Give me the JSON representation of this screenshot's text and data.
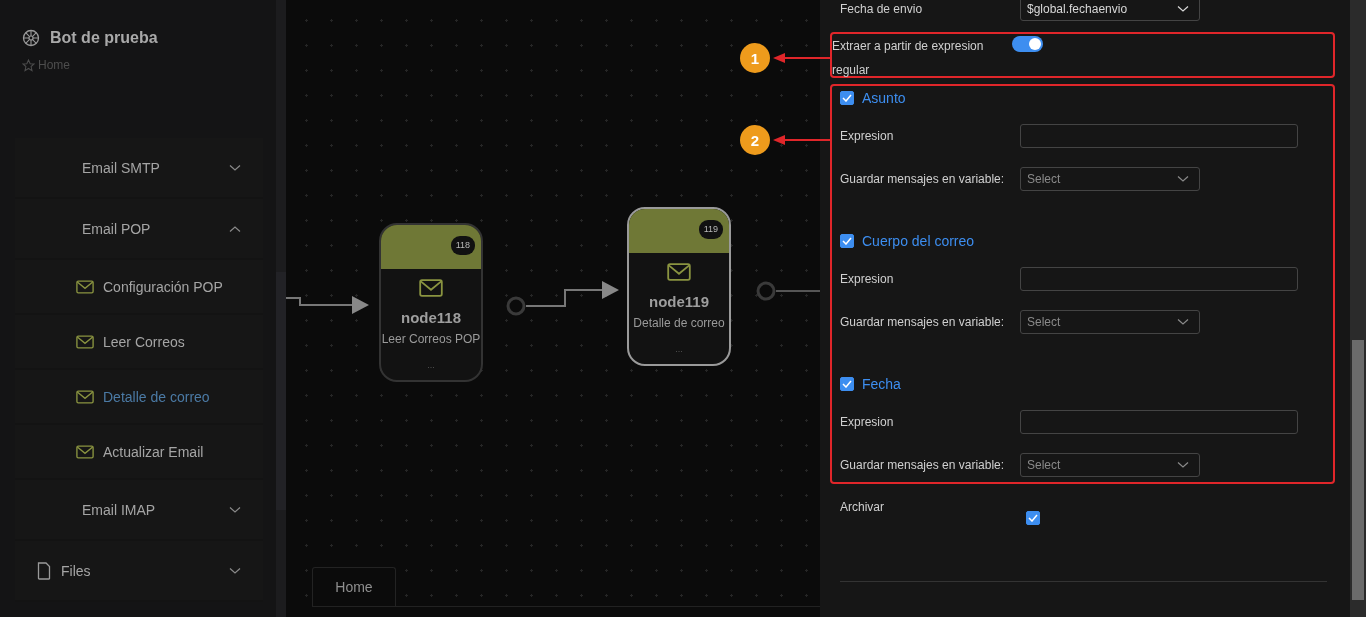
{
  "app": {
    "title": "Bot de prueba",
    "breadcrumb": "Home"
  },
  "menu": [
    {
      "kind": "subgroup",
      "label": "Email SMTP",
      "expanded": false
    },
    {
      "kind": "subgroup",
      "label": "Email POP",
      "expanded": true,
      "children": [
        {
          "label": "Configuración POP",
          "selected": false
        },
        {
          "label": "Leer Correos",
          "selected": false
        },
        {
          "label": "Detalle de correo",
          "selected": true
        },
        {
          "label": "Actualizar Email",
          "selected": false
        }
      ]
    },
    {
      "kind": "subgroup",
      "label": "Email IMAP",
      "expanded": false
    },
    {
      "kind": "group",
      "label": "Files",
      "expanded": false
    }
  ],
  "canvas": {
    "nodes": [
      {
        "title": "node118",
        "number": "118",
        "subtitle": "Leer Correos POP",
        "more": "...",
        "selected": false
      },
      {
        "title": "node119",
        "number": "119",
        "subtitle": "Detalle de correo",
        "more": "...",
        "selected": true
      }
    ],
    "tabs": [
      {
        "label": "Home",
        "selected": true
      }
    ]
  },
  "callouts": [
    {
      "number": "1"
    },
    {
      "number": "2"
    }
  ],
  "panel": {
    "send_date": {
      "label": "Fecha de envio",
      "value": "$global.fechaenvio"
    },
    "regex_toggle": {
      "label": "Extraer a partir de expresion regular",
      "on": true
    },
    "fields": [
      {
        "label": "Asunto",
        "checked": true,
        "expression_label": "Expresion",
        "variable_label": "Guardar mensajes en variable:",
        "variable_placeholder": "Select"
      },
      {
        "label": "Cuerpo del correo",
        "checked": true,
        "expression_label": "Expresion",
        "variable_label": "Guardar mensajes en variable:",
        "variable_placeholder": "Select"
      },
      {
        "label": "Fecha",
        "checked": true,
        "expression_label": "Expresion",
        "variable_label": "Guardar mensajes en variable:",
        "variable_placeholder": "Select"
      }
    ],
    "archive": {
      "label": "Archivar",
      "checked": true
    }
  }
}
